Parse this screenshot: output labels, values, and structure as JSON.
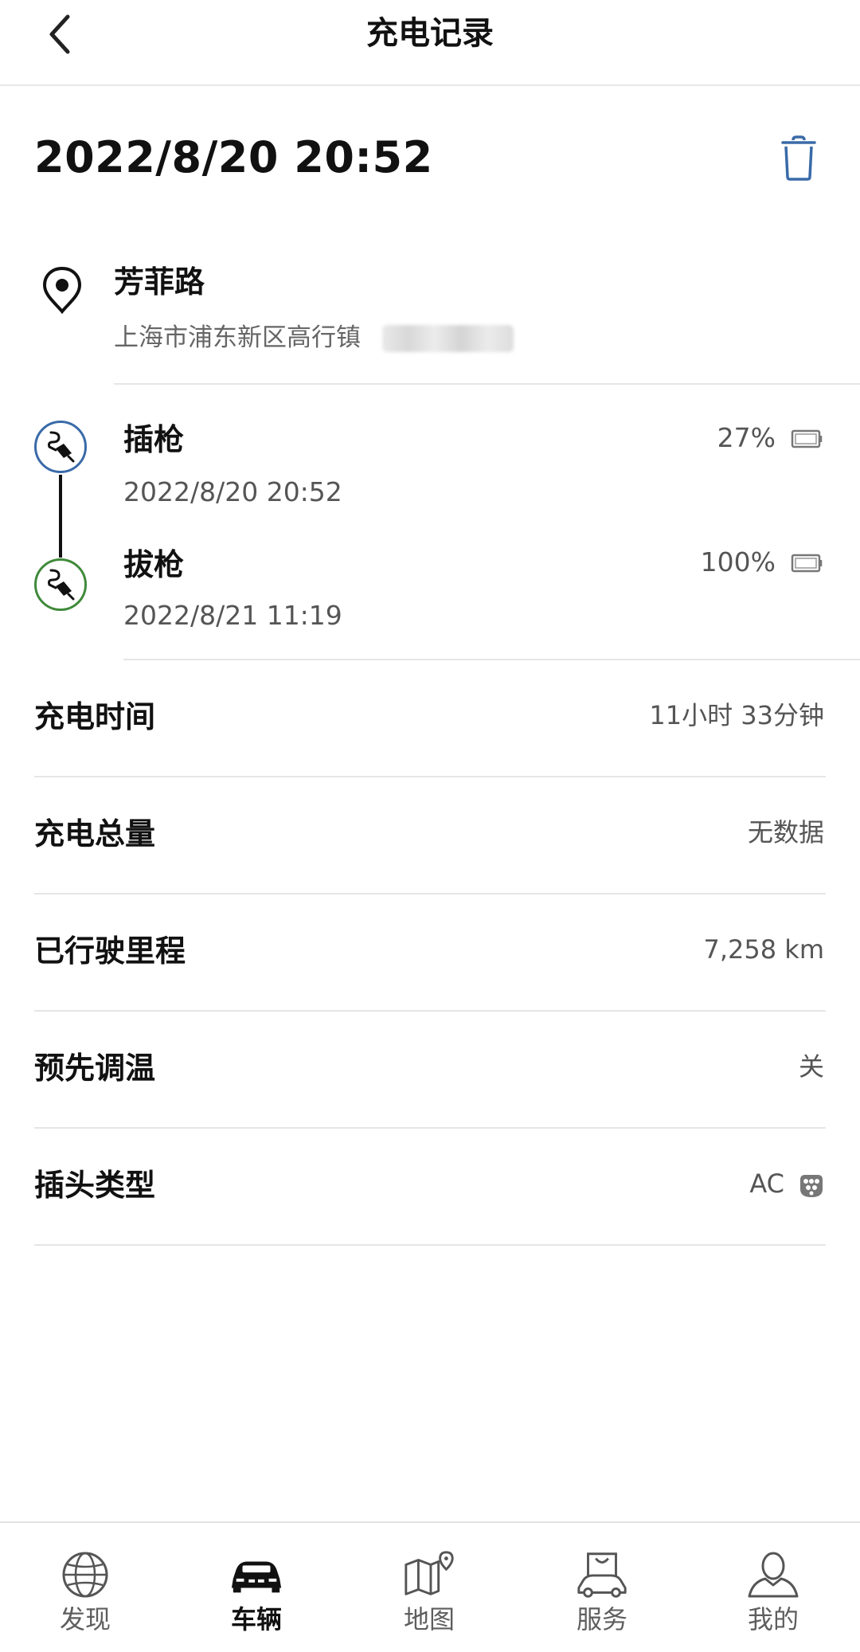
{
  "header": {
    "title": "充电记录"
  },
  "record": {
    "date": "2022/8/20 20:52"
  },
  "location": {
    "name": "芳菲路",
    "address": "上海市浦东新区高行镇"
  },
  "timeline": {
    "plug_in": {
      "label": "插枪",
      "time": "2022/8/20 20:52",
      "battery": "27%"
    },
    "plug_out": {
      "label": "拔枪",
      "time": "2022/8/21 11:19",
      "battery": "100%"
    }
  },
  "details": [
    {
      "label": "充电时间",
      "value": "11小时 33分钟"
    },
    {
      "label": "充电总量",
      "value": "无数据"
    },
    {
      "label": "已行驶里程",
      "value": "7,258 km"
    },
    {
      "label": "预先调温",
      "value": "关"
    },
    {
      "label": "插头类型",
      "value": "AC"
    }
  ],
  "nav": {
    "items": [
      {
        "label": "发现",
        "icon": "globe-icon"
      },
      {
        "label": "车辆",
        "icon": "car-icon",
        "active": true
      },
      {
        "label": "地图",
        "icon": "map-icon"
      },
      {
        "label": "服务",
        "icon": "service-icon"
      },
      {
        "label": "我的",
        "icon": "profile-icon"
      }
    ]
  },
  "colors": {
    "plug_in_ring": "#3a6aa8",
    "plug_out_ring": "#3f8a3a",
    "trash_blue": "#3a6aa8",
    "divider": "#e6e6e6"
  }
}
